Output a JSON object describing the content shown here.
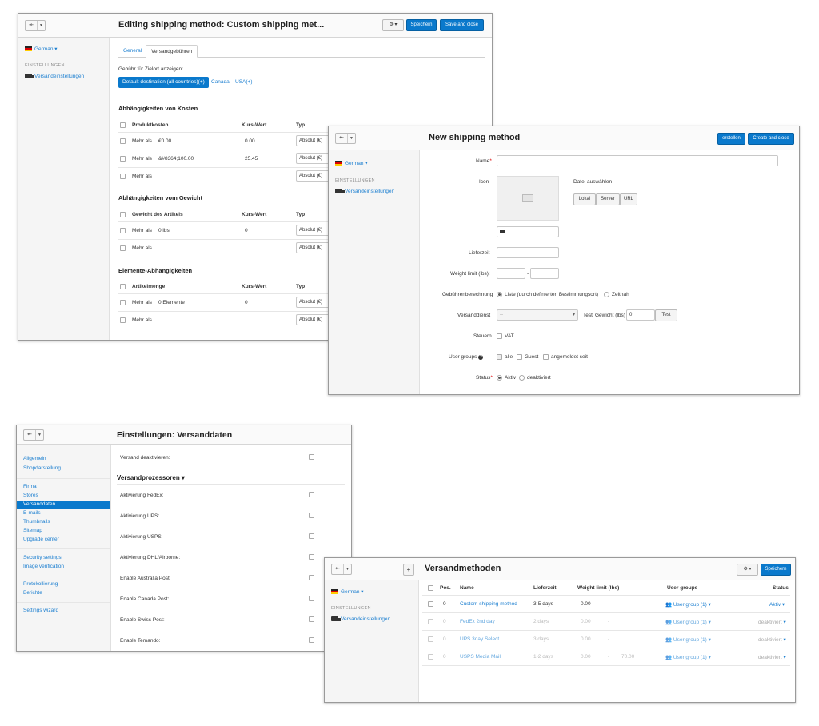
{
  "p1": {
    "title": "Editing shipping method: Custom shipping met...",
    "nav_back_icon": "back-arrow-icon",
    "gear_icon": "gear-icon",
    "save_label": "Speichern",
    "save_close_label": "Save and close",
    "language": "German",
    "sidebar_section": "EINSTELLUNGEN",
    "sidebar_item": "Versandeinstellungen",
    "tabs": [
      "General",
      "Versandgebühren"
    ],
    "dest_label": "Gebühr für Zielort anzeigen:",
    "dest_pills": [
      "Default destination (all countries)(+)",
      "Canada",
      "USA(+)"
    ],
    "sections": [
      {
        "title": "Abhängigkeiten von Kosten",
        "headers": [
          "Produktkosten",
          "Kurs-Wert",
          "Typ"
        ],
        "rows": [
          {
            "label": "Mehr als",
            "value": "€0.00",
            "rate": "0.00",
            "type": "Absolut (€)"
          },
          {
            "label": "Mehr als",
            "value": "&#8364;100.00",
            "rate": "25.45",
            "type": "Absolut (€)"
          },
          {
            "label": "Mehr als",
            "value": "",
            "rate": "",
            "type": "Absolut (€)"
          }
        ]
      },
      {
        "title": "Abhängigkeiten vom Gewicht",
        "headers": [
          "Gewicht des Artikels",
          "Kurs-Wert",
          "Typ"
        ],
        "rows": [
          {
            "label": "Mehr als",
            "value": "0 lbs",
            "rate": "0",
            "type": "Absolut (€)"
          },
          {
            "label": "Mehr als",
            "value": "",
            "rate": "",
            "type": "Absolut (€)"
          }
        ]
      },
      {
        "title": "Elemente-Abhängigkeiten",
        "headers": [
          "Artikelmenge",
          "Kurs-Wert",
          "Typ"
        ],
        "rows": [
          {
            "label": "Mehr als",
            "value": "0 Elemente",
            "rate": "0",
            "type": "Absolut (€)"
          },
          {
            "label": "Mehr als",
            "value": "",
            "rate": "",
            "type": "Absolut (€)"
          }
        ]
      }
    ]
  },
  "p2": {
    "title": "New shipping method",
    "create_label": "erstellen",
    "create_close_label": "Create and close",
    "language": "German",
    "sidebar_section": "EINSTELLUNGEN",
    "sidebar_item": "Versandeinstellungen",
    "name_label": "Name",
    "icon_label": "Icon",
    "file_label": "Datei auswählen",
    "file_buttons": [
      "Lokal",
      "Server",
      "URL"
    ],
    "delivery_label": "Lieferzeit",
    "weight_label": "Weight limit (lbs):",
    "weight_sep": "-",
    "rate_calc_label": "Gebührenberechnung",
    "rate_calc_options": [
      "Liste (durch definierten Bestimmungsort)",
      "Zeitnah"
    ],
    "carrier_label": "Versanddienst",
    "carrier_value": "--",
    "test_label": "Test",
    "weight_test_label": "Gewicht (lbs)",
    "weight_test_value": "0",
    "test_button": "Test",
    "taxes_label": "Steuern",
    "taxes_option": "VAT",
    "usergroups_label": "User groups",
    "usergroups_options": [
      "alle",
      "Guest",
      "angemeldet seit"
    ],
    "status_label": "Status",
    "status_options": [
      "Aktiv",
      "deaktiviert"
    ]
  },
  "p3": {
    "title": "Einstellungen: Versanddaten",
    "nav": [
      "Allgemein",
      "Shopdarstellung",
      "Firma",
      "Stores",
      "Versanddaten",
      "E-mails",
      "Thumbnails",
      "Sitemap",
      "Upgrade center",
      "Security settings",
      "Image verification",
      "Protokollierung",
      "Berichte",
      "Settings wizard"
    ],
    "active_nav": "Versanddaten",
    "disable_label": "Versand deaktivieren:",
    "processors_title": "Versandprozessoren",
    "processors": [
      "Aktivierung FedEx:",
      "Aktivierung UPS:",
      "Aktivierung USPS:",
      "Aktivierung DHL/Airborne:",
      "Enable Australia Post:",
      "Enable Canada Post:",
      "Enable Swiss Post:",
      "Enable Temando:"
    ]
  },
  "p4": {
    "title": "Versandmethoden",
    "add_label": "+",
    "save_label": "Speichern",
    "language": "German",
    "sidebar_section": "EINSTELLUNGEN",
    "sidebar_item": "Versandeinstellungen",
    "headers": [
      "Pos.",
      "Name",
      "Lieferzeit",
      "Weight limit (lbs)",
      "User groups",
      "Status"
    ],
    "rows": [
      {
        "pos": "0",
        "name": "Custom shipping method",
        "delivery": "3-5 days",
        "wmin": "0.00",
        "sep": "-",
        "wmax": "",
        "group": "User group (1)",
        "status": "Aktiv",
        "active": true
      },
      {
        "pos": "0",
        "name": "FedEx 2nd day",
        "delivery": "2 days",
        "wmin": "0.00",
        "sep": "-",
        "wmax": "",
        "group": "User group (1)",
        "status": "deaktiviert",
        "active": false
      },
      {
        "pos": "0",
        "name": "UPS 3day Select",
        "delivery": "3 days",
        "wmin": "0.00",
        "sep": "-",
        "wmax": "",
        "group": "User group (1)",
        "status": "deaktiviert",
        "active": false
      },
      {
        "pos": "0",
        "name": "USPS Media Mail",
        "delivery": "1-2 days",
        "wmin": "0.00",
        "sep": "-",
        "wmax": "70.00",
        "group": "User group (1)",
        "status": "deaktiviert",
        "active": false
      }
    ]
  }
}
